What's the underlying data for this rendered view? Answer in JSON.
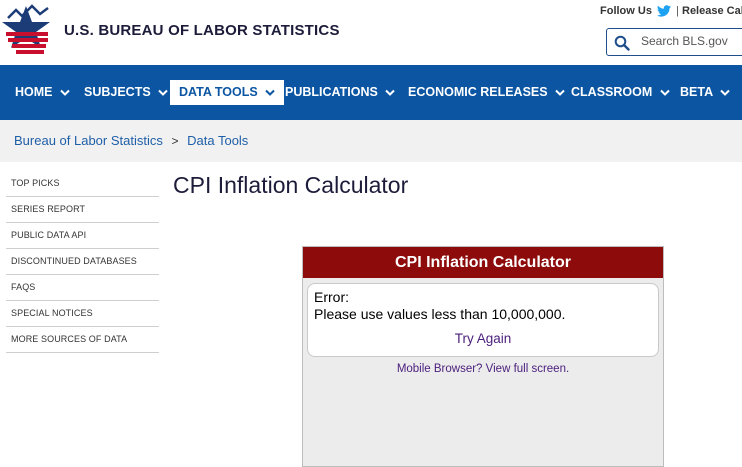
{
  "header": {
    "agency_name": "U.S. BUREAU OF LABOR STATISTICS",
    "follow_label": "Follow Us",
    "separator": "|",
    "release_label": "Release Cale",
    "search_placeholder": "Search BLS.gov"
  },
  "nav": {
    "items": [
      {
        "label": "HOME"
      },
      {
        "label": "SUBJECTS"
      },
      {
        "label": "DATA TOOLS",
        "active": true
      },
      {
        "label": "PUBLICATIONS"
      },
      {
        "label": "ECONOMIC RELEASES"
      },
      {
        "label": "CLASSROOM"
      },
      {
        "label": "BETA"
      }
    ]
  },
  "breadcrumb": {
    "items": [
      "Bureau of Labor Statistics",
      "Data Tools"
    ],
    "separator": ">"
  },
  "sidebar": {
    "items": [
      "TOP PICKS",
      "SERIES REPORT",
      "PUBLIC DATA API",
      "DISCONTINUED DATABASES",
      "FAQS",
      "SPECIAL NOTICES",
      "MORE SOURCES OF DATA"
    ]
  },
  "main": {
    "title": "CPI Inflation Calculator"
  },
  "calculator": {
    "header": "CPI Inflation Calculator",
    "error_label": "Error:",
    "error_message": "Please use values less than 10,000,000.",
    "try_again": "Try Again",
    "mobile_link": "Mobile Browser? View full screen."
  },
  "colors": {
    "nav_blue": "#0b55a3",
    "calc_header_red": "#8e0b0b",
    "link_blue": "#1f5fa8",
    "link_purple": "#4a1e7d"
  }
}
